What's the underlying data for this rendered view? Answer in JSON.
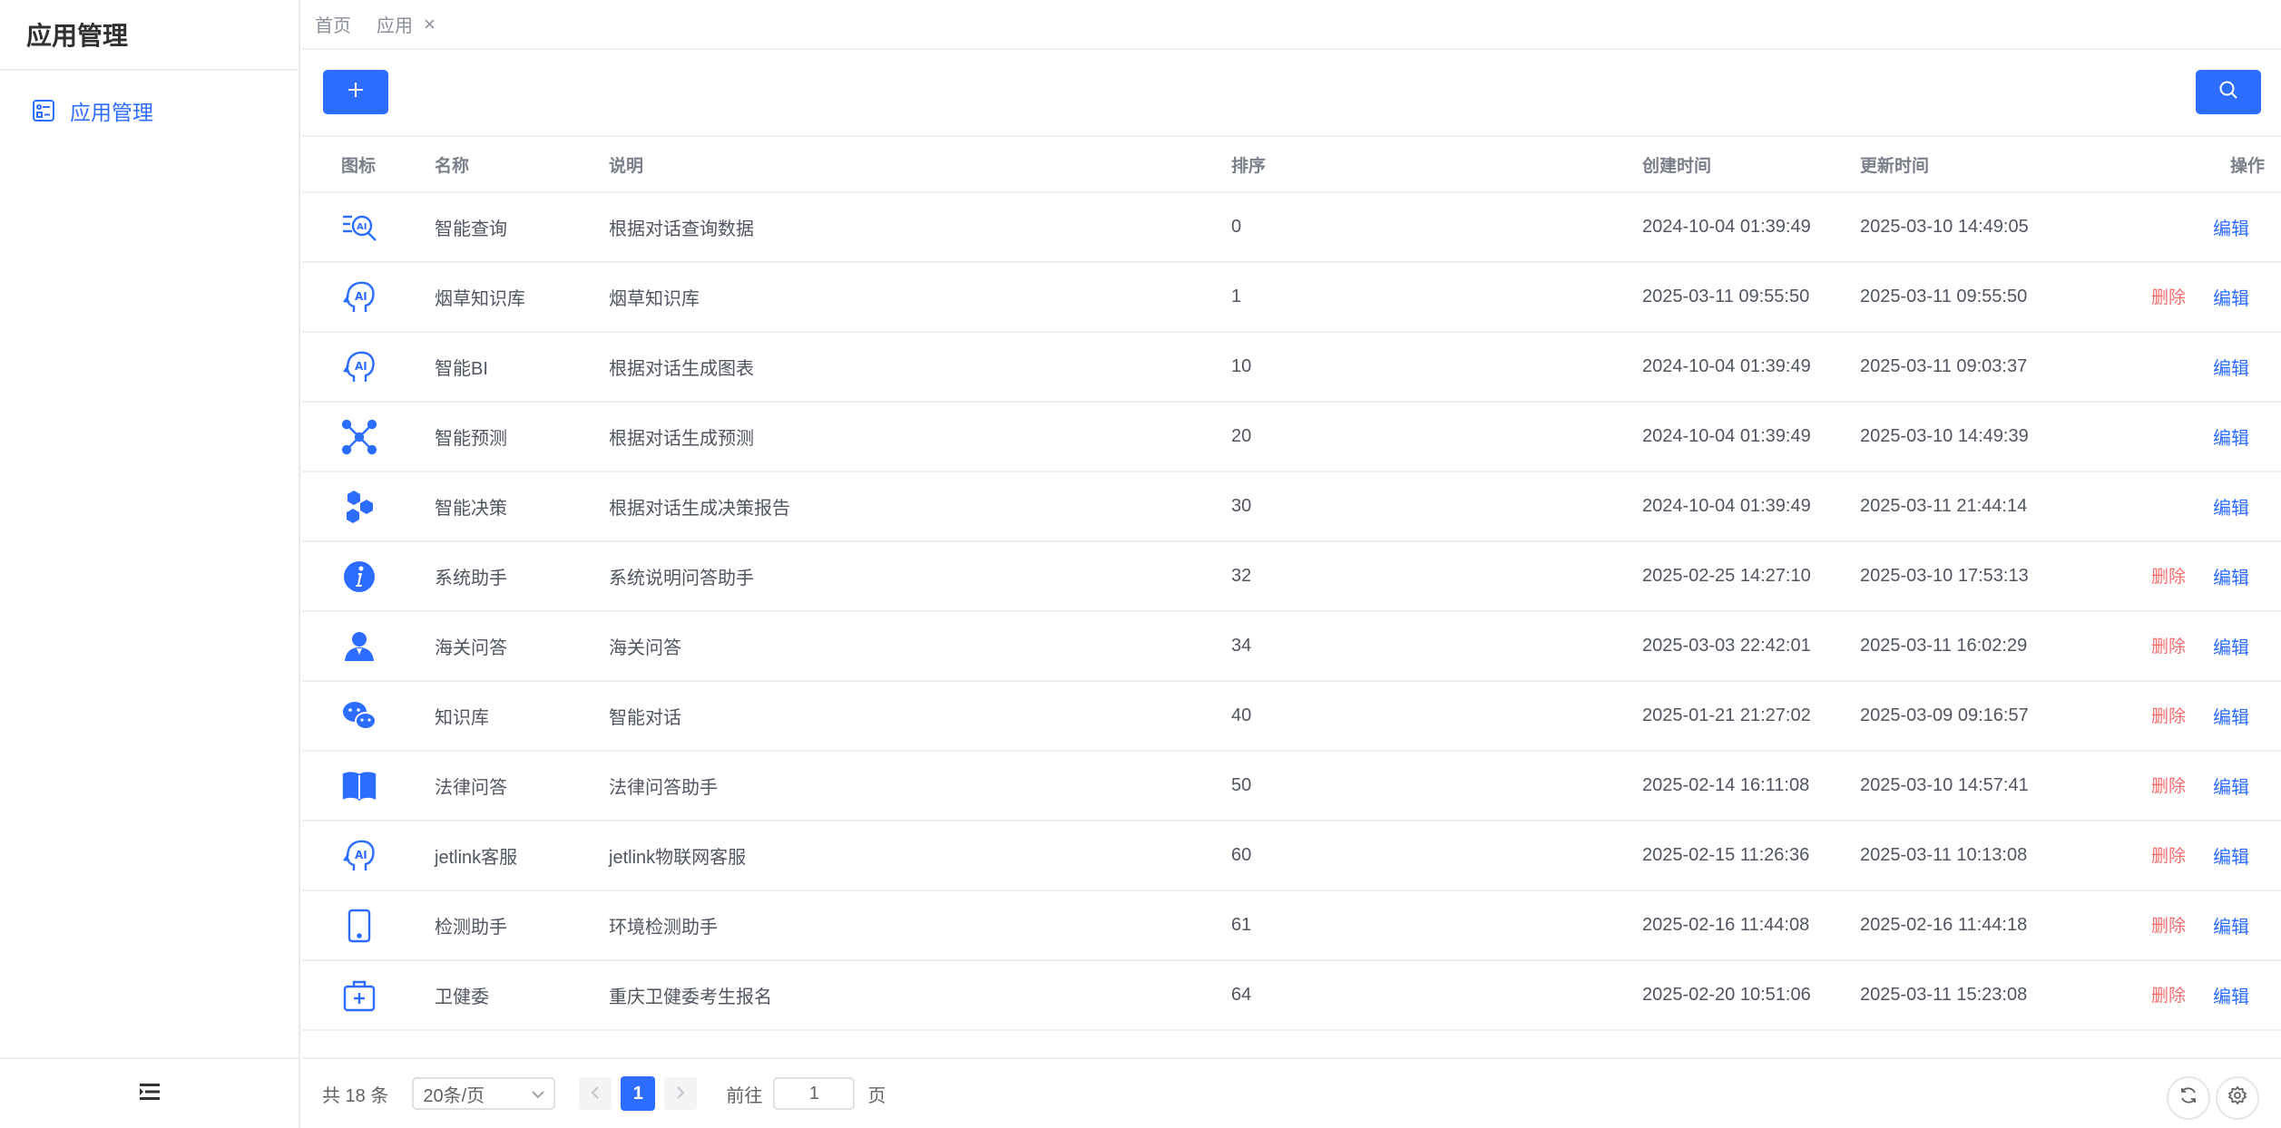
{
  "sidebar": {
    "title": "应用管理",
    "items": [
      {
        "label": "应用管理",
        "icon": "app-list-icon"
      }
    ],
    "collapse_icon": "menu-collapse-icon"
  },
  "tabs": [
    {
      "label": "首页"
    },
    {
      "label": "应用"
    }
  ],
  "tab_close": "×",
  "toolbar": {
    "add_icon": "plus-icon",
    "search_icon": "search-icon"
  },
  "table": {
    "headers": {
      "icon": "图标",
      "name": "名称",
      "desc": "说明",
      "order": "排序",
      "created": "创建时间",
      "updated": "更新时间",
      "ops": "操作"
    },
    "delete_label": "删除",
    "edit_label": "编辑",
    "rows": [
      {
        "icon": "ai-search-icon",
        "name": "智能查询",
        "desc": "根据对话查询数据",
        "order": "0",
        "created": "2024-10-04 01:39:49",
        "updated": "2025-03-10 14:49:05",
        "deletable": false
      },
      {
        "icon": "ai-head-icon",
        "name": "烟草知识库",
        "desc": "烟草知识库",
        "order": "1",
        "created": "2025-03-11 09:55:50",
        "updated": "2025-03-11 09:55:50",
        "deletable": true
      },
      {
        "icon": "ai-head-icon",
        "name": "智能BI",
        "desc": "根据对话生成图表",
        "order": "10",
        "created": "2024-10-04 01:39:49",
        "updated": "2025-03-11 09:03:37",
        "deletable": false
      },
      {
        "icon": "network-nodes-icon",
        "name": "智能预测",
        "desc": "根据对话生成预测",
        "order": "20",
        "created": "2024-10-04 01:39:49",
        "updated": "2025-03-10 14:49:39",
        "deletable": false
      },
      {
        "icon": "hexagons-icon",
        "name": "智能决策",
        "desc": "根据对话生成决策报告",
        "order": "30",
        "created": "2024-10-04 01:39:49",
        "updated": "2025-03-11 21:44:14",
        "deletable": false
      },
      {
        "icon": "info-icon",
        "name": "系统助手",
        "desc": "系统说明问答助手",
        "order": "32",
        "created": "2025-02-25 14:27:10",
        "updated": "2025-03-10 17:53:13",
        "deletable": true
      },
      {
        "icon": "user-icon",
        "name": "海关问答",
        "desc": "海关问答",
        "order": "34",
        "created": "2025-03-03 22:42:01",
        "updated": "2025-03-11 16:02:29",
        "deletable": true
      },
      {
        "icon": "wechat-icon",
        "name": "知识库",
        "desc": "智能对话",
        "order": "40",
        "created": "2025-01-21 21:27:02",
        "updated": "2025-03-09 09:16:57",
        "deletable": true
      },
      {
        "icon": "book-icon",
        "name": "法律问答",
        "desc": "法律问答助手",
        "order": "50",
        "created": "2025-02-14 16:11:08",
        "updated": "2025-03-10 14:57:41",
        "deletable": true
      },
      {
        "icon": "ai-head-icon",
        "name": "jetlink客服",
        "desc": "jetlink物联网客服",
        "order": "60",
        "created": "2025-02-15 11:26:36",
        "updated": "2025-03-11 10:13:08",
        "deletable": true
      },
      {
        "icon": "tablet-icon",
        "name": "检测助手",
        "desc": "环境检测助手",
        "order": "61",
        "created": "2025-02-16 11:44:08",
        "updated": "2025-02-16 11:44:18",
        "deletable": true
      },
      {
        "icon": "medical-kit-icon",
        "name": "卫健委",
        "desc": "重庆卫健委考生报名",
        "order": "64",
        "created": "2025-02-20 10:51:06",
        "updated": "2025-03-11 15:23:08",
        "deletable": true
      }
    ]
  },
  "pager": {
    "total": "共 18 条",
    "page_size": "20条/页",
    "current_page": "1",
    "goto_label": "前往",
    "goto_value": "1",
    "page_unit": "页"
  },
  "colors": {
    "primary": "#2c6cff",
    "danger": "#f56c6c"
  }
}
